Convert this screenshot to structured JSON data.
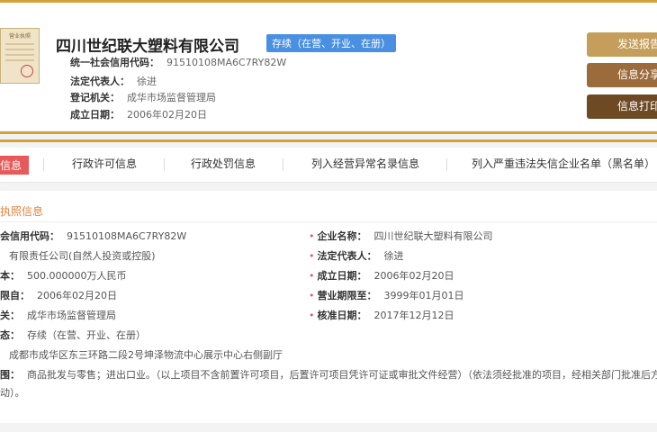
{
  "header": {
    "license_image_title": "营业执照",
    "company_name": "四川世纪联大塑料有限公司",
    "status": "存续（在营、开业、在册）",
    "credit_code_label": "统一社会信用代码：",
    "credit_code_value": "91510108MA6C7RY82W",
    "legal_rep_label": "法定代表人：",
    "legal_rep_value": "徐进",
    "authority_label": "登记机关：",
    "authority_value": "成华市场监督管理局",
    "established_label": "成立日期：",
    "established_value": "2006年02月20日"
  },
  "actions": {
    "send_report": "发送报告",
    "share": "信息分享",
    "print": "信息打印"
  },
  "tabs": {
    "t0": "信息",
    "t1": "行政许可信息",
    "t2": "行政处罚信息",
    "t3": "列入经营异常名录信息",
    "t4": "列入严重违法失信企业名单（黑名单）"
  },
  "detail": {
    "section_title": "执照信息",
    "credit_code_label": "会信用代码：",
    "credit_code_value": "91510108MA6C7RY82W",
    "company_name_label": "企业名称：",
    "company_name_value": "四川世纪联大塑料有限公司",
    "type_value": "有限责任公司(自然人投资或控股)",
    "legal_rep_label": "法定代表人：",
    "legal_rep_value": "徐进",
    "capital_label": "本：",
    "capital_value": "500.000000万人民币",
    "established_label": "成立日期：",
    "established_value": "2006年02月20日",
    "term_from_label": "限自：",
    "term_from_value": "2006年02月20日",
    "term_to_label": "营业期限至：",
    "term_to_value": "3999年01月01日",
    "authority_label": "关：",
    "authority_value": "成华市场监督管理局",
    "approved_label": "核准日期：",
    "approved_value": "2017年12月12日",
    "status_label": "态：",
    "status_value": "存续（在营、开业、在册）",
    "address_value": "成都市成华区东三环路二段2号坤泽物流中心展示中心右侧副厅",
    "scope_label": "围：",
    "scope_value": "商品批发与零售；进出口业。（以上项目不含前置许可项目，后置许可项目凭许可证或审批文件经营）（依法须经批准的项目，经相关部门批准后方可",
    "scope_cont": "动）。"
  }
}
